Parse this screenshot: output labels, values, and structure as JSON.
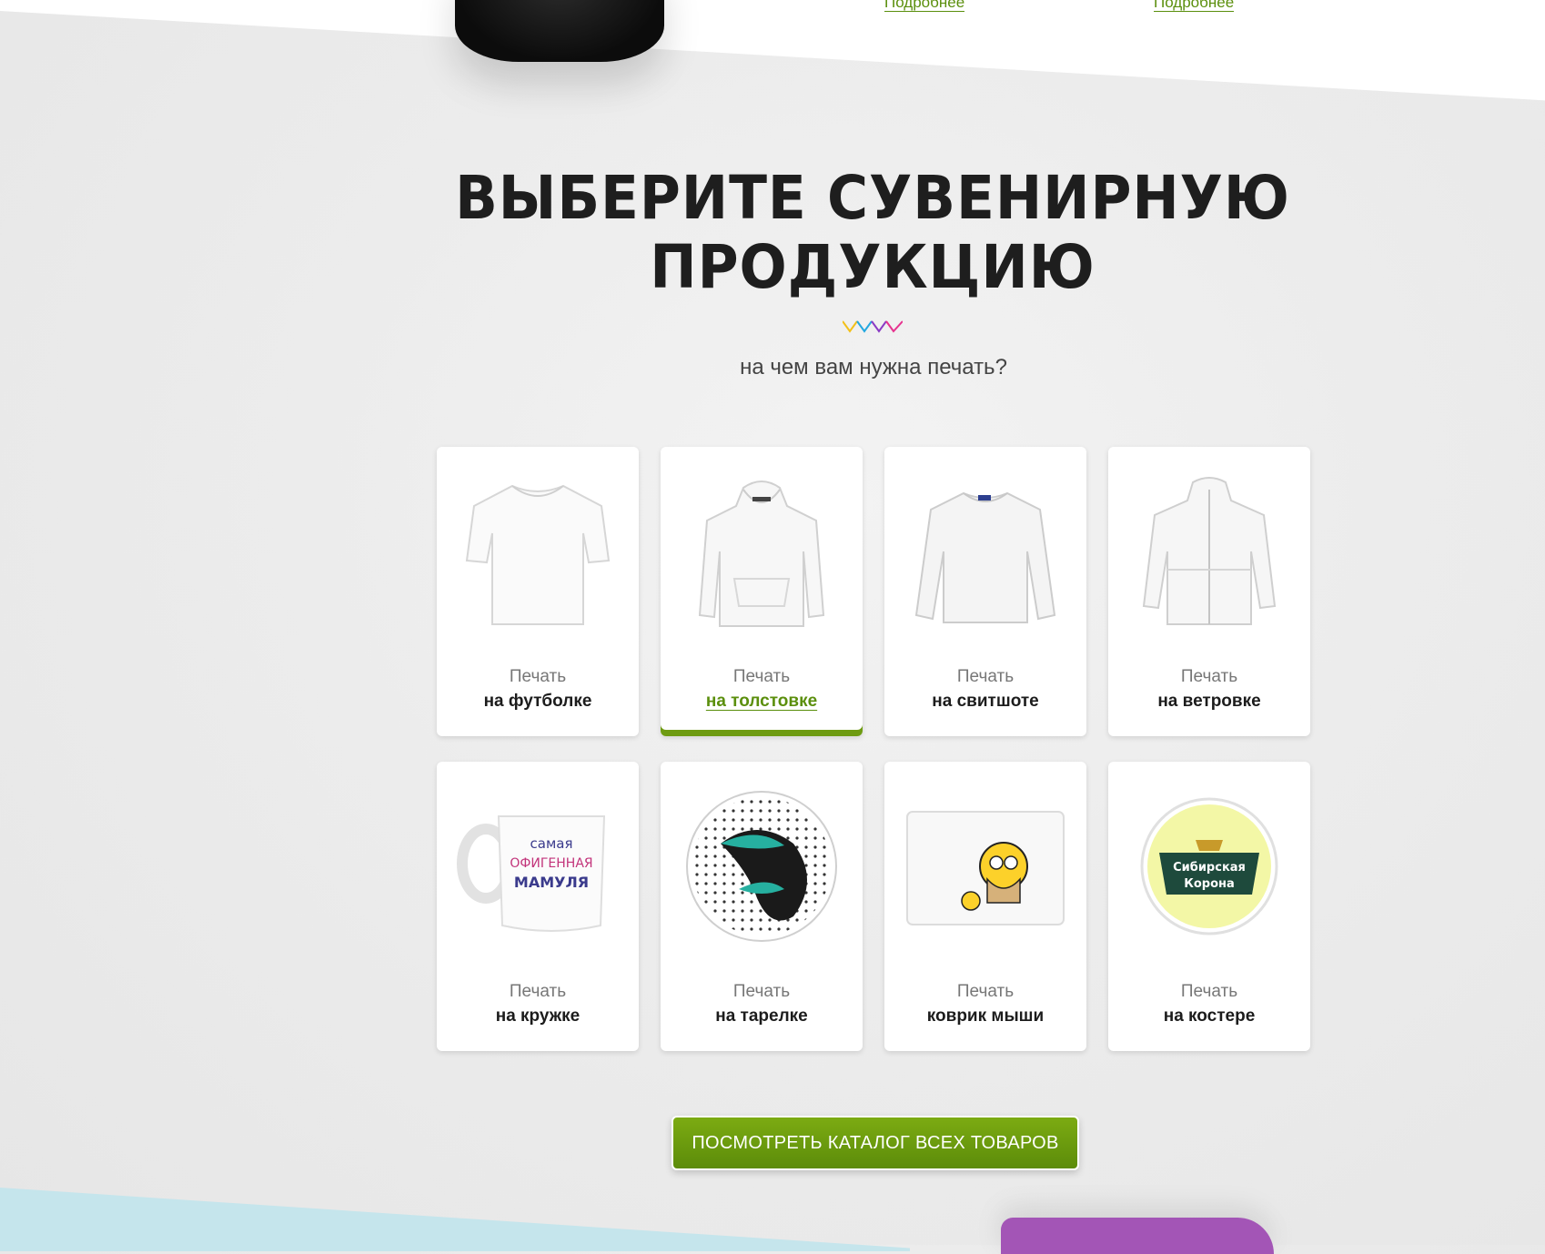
{
  "top": {
    "more_link_1": "Подробнее",
    "more_link_2": "Подробнее"
  },
  "section": {
    "title_line1": "ВЫБЕРИТЕ СУВЕНИРНУЮ",
    "title_line2": "ПРОДУКЦИЮ",
    "subtitle": "на чем вам нужна печать?"
  },
  "products": [
    {
      "line1": "Печать",
      "line2": "на футболке",
      "icon": "tshirt-icon"
    },
    {
      "line1": "Печать",
      "line2": "на толстовке",
      "icon": "hoodie-icon",
      "active": true
    },
    {
      "line1": "Печать",
      "line2": "на свитшоте",
      "icon": "sweatshirt-icon"
    },
    {
      "line1": "Печать",
      "line2": "на ветровке",
      "icon": "windbreaker-icon"
    },
    {
      "line1": "Печать",
      "line2": "на кружке",
      "icon": "mug-icon"
    },
    {
      "line1": "Печать",
      "line2": "на тарелке",
      "icon": "plate-icon"
    },
    {
      "line1": "Печать",
      "line2": "коврик мыши",
      "icon": "mousepad-icon"
    },
    {
      "line1": "Печать",
      "line2": "на костере",
      "icon": "coaster-icon"
    }
  ],
  "mug_print": {
    "line1": "самая",
    "line2": "ОФИГЕННАЯ",
    "line3": "МАМУЛЯ"
  },
  "coaster_print": {
    "line1": "Сибирская",
    "line2": "Корона"
  },
  "cta": {
    "label": "ПОСМОТРЕТЬ КАТАЛОГ ВСЕХ ТОВАРОВ"
  },
  "colors": {
    "accent": "#5b8f0d",
    "button": "#6e9b12",
    "heading": "#1e1e1e"
  }
}
